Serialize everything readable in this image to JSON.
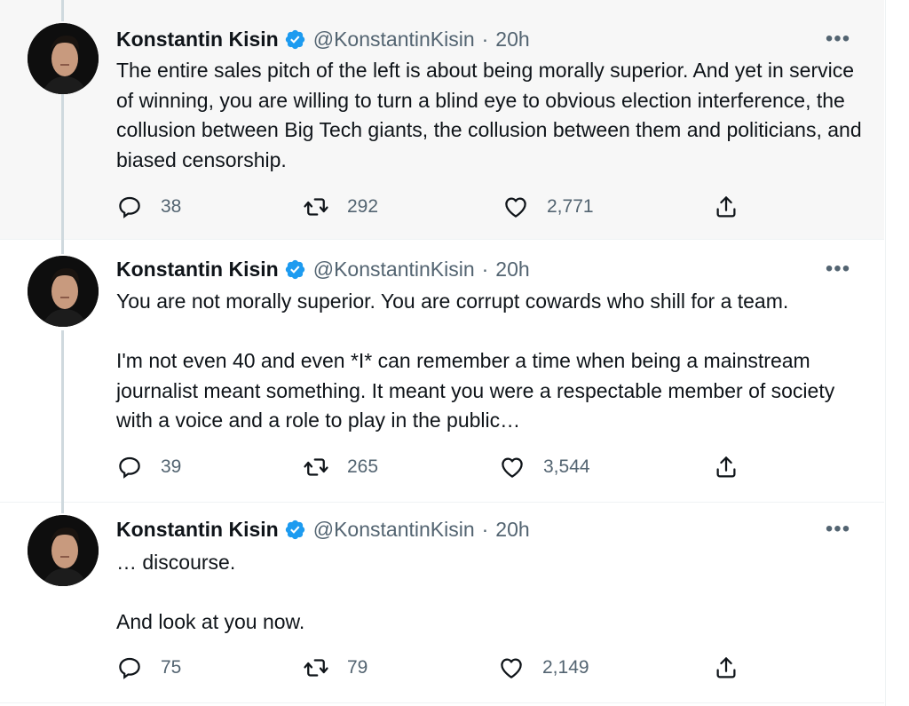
{
  "tweets": [
    {
      "author": {
        "name": "Konstantin Kisin",
        "handle": "@KonstantinKisin",
        "sep": "·",
        "time": "20h"
      },
      "more_label": "•••",
      "paragraphs": [
        "The entire sales pitch of the left is about being morally superior. And yet in service of winning, you are willing to turn a blind eye to obvious election interference, the collusion between Big Tech giants, the collusion between them and politicians, and biased censorship."
      ],
      "stats": {
        "replies": "38",
        "retweets": "292",
        "likes": "2,771"
      },
      "highlighted": true
    },
    {
      "author": {
        "name": "Konstantin Kisin",
        "handle": "@KonstantinKisin",
        "sep": "·",
        "time": "20h"
      },
      "more_label": "•••",
      "paragraphs": [
        "You are not morally superior. You are corrupt cowards who shill for a team.",
        "I'm not even 40 and even *I* can remember a time when being a mainstream journalist meant something. It meant you were a respectable member of society with a voice and a role to play in the public…"
      ],
      "stats": {
        "replies": "39",
        "retweets": "265",
        "likes": "3,544"
      },
      "highlighted": false
    },
    {
      "author": {
        "name": "Konstantin Kisin",
        "handle": "@KonstantinKisin",
        "sep": "·",
        "time": "20h"
      },
      "more_label": "•••",
      "paragraphs": [
        "… discourse.",
        "And look at you now."
      ],
      "stats": {
        "replies": "75",
        "retweets": "79",
        "likes": "2,149"
      },
      "highlighted": false
    }
  ],
  "icons": {
    "verified": "verified-badge-icon",
    "reply": "reply-icon",
    "retweet": "retweet-icon",
    "like": "heart-icon",
    "share": "share-icon",
    "more": "more-icon"
  },
  "colors": {
    "verified": "#1d9bf0",
    "muted": "#536471",
    "text": "#0f1419",
    "highlight_bg": "#f7f7f7",
    "thread_line": "#cfd9de"
  }
}
